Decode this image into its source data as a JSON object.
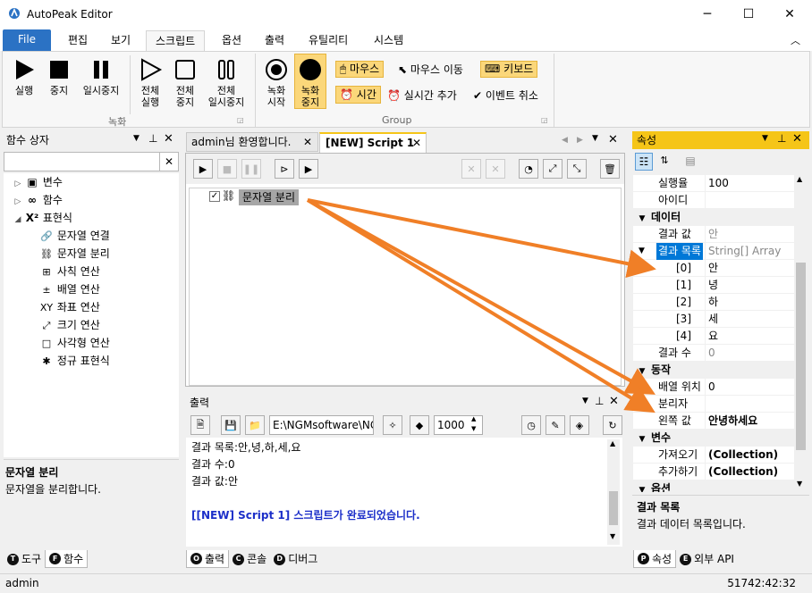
{
  "window": {
    "title": "AutoPeak Editor",
    "minimize": "─",
    "maximize": "☐",
    "close": "✕"
  },
  "ribbon_tabs": [
    "File",
    "편집",
    "보기",
    "스크립트",
    "옵션",
    "출력",
    "유틸리티",
    "시스템"
  ],
  "ribbon": {
    "record_group_label": "녹화",
    "group_label": "Group",
    "run": "실행",
    "stop": "중지",
    "pause": "일시중지",
    "run_all_1": "전체",
    "run_all_2": "실행",
    "stop_all_1": "전체",
    "stop_all_2": "중지",
    "pause_all_1": "전체",
    "pause_all_2": "일시중지",
    "rec_start_1": "녹화",
    "rec_start_2": "시작",
    "rec_stop_1": "녹화",
    "rec_stop_2": "중지",
    "mouse": "마우스",
    "mouse_move": "마우스 이동",
    "keyboard": "키보드",
    "time": "시간",
    "realtime_add": "실시간 추가",
    "event_cancel": "이벤트 취소"
  },
  "func_panel": {
    "title": "함수 상자",
    "tree": [
      {
        "label": "변수",
        "icon": "variables-icon",
        "glyph": "▣",
        "expander": "▷"
      },
      {
        "label": "함수",
        "icon": "function-icon",
        "glyph": "∞",
        "expander": "▷"
      },
      {
        "label": "표현식",
        "icon": "expression-icon",
        "glyph": "X²",
        "expander": "◢"
      }
    ],
    "children": [
      {
        "label": "문자열 연결",
        "icon": "link-icon",
        "glyph": "🔗"
      },
      {
        "label": "문자열 분리",
        "icon": "unlink-icon",
        "glyph": "⛓"
      },
      {
        "label": "사칙 연산",
        "icon": "arithmetic-icon",
        "glyph": "⊞"
      },
      {
        "label": "배열 연산",
        "icon": "plus-minus-icon",
        "glyph": "±"
      },
      {
        "label": "좌표 연산",
        "icon": "xy-icon",
        "glyph": "XY"
      },
      {
        "label": "크기 연산",
        "icon": "resize-icon",
        "glyph": "⤢"
      },
      {
        "label": "사각형 연산",
        "icon": "rectangle-icon",
        "glyph": "□"
      },
      {
        "label": "정규 표현식",
        "icon": "asterisk-icon",
        "glyph": "✱"
      }
    ],
    "desc_title": "문자열 분리",
    "desc_text": "문자열을 분리합니다.",
    "tabs": [
      {
        "label": "도구",
        "letter": "T"
      },
      {
        "label": "함수",
        "letter": "F"
      }
    ]
  },
  "editor": {
    "tabs": [
      "admin님 환영합니다.",
      "[NEW] Script 1"
    ],
    "node_label": "문자열 분리"
  },
  "output": {
    "title": "출력",
    "path": "E:\\NGMsoftware\\NG",
    "size": "1000",
    "lines": [
      "결과 목록:안,녕,하,세,요",
      "결과 수:0",
      "결과 값:안"
    ],
    "done_line": "[[NEW] Script 1] 스크립트가 완료되었습니다.",
    "tabs": [
      {
        "label": "출력",
        "letter": "O"
      },
      {
        "label": "콘솔",
        "letter": "C"
      },
      {
        "label": "디버그",
        "letter": "D"
      }
    ]
  },
  "props": {
    "title": "속성",
    "rows": [
      {
        "kind": "row",
        "name": "실행율",
        "value": "100"
      },
      {
        "kind": "row",
        "name": "아이디",
        "value": ""
      },
      {
        "kind": "cat",
        "name": "데이터"
      },
      {
        "kind": "row",
        "name": "결과 값",
        "value": "안",
        "gray": true
      },
      {
        "kind": "row",
        "name": "결과 목록",
        "value": "String[] Array",
        "sel": true,
        "gray": true
      },
      {
        "kind": "sub",
        "name": "[0]",
        "value": "안"
      },
      {
        "kind": "sub",
        "name": "[1]",
        "value": "녕"
      },
      {
        "kind": "sub",
        "name": "[2]",
        "value": "하"
      },
      {
        "kind": "sub",
        "name": "[3]",
        "value": "세"
      },
      {
        "kind": "sub",
        "name": "[4]",
        "value": "요"
      },
      {
        "kind": "row",
        "name": "결과 수",
        "value": "0",
        "gray": true
      },
      {
        "kind": "cat",
        "name": "동작"
      },
      {
        "kind": "row",
        "name": "배열 위치",
        "value": "0"
      },
      {
        "kind": "row",
        "name": "분리자",
        "value": ""
      },
      {
        "kind": "row",
        "name": "왼쪽 값",
        "value": "안녕하세요",
        "bold": true
      },
      {
        "kind": "cat",
        "name": "변수"
      },
      {
        "kind": "row",
        "name": "가져오기",
        "value": "(Collection)",
        "bold": true
      },
      {
        "kind": "row",
        "name": "추가하기",
        "value": "(Collection)",
        "bold": true
      },
      {
        "kind": "cat",
        "name": "옵션"
      }
    ],
    "desc_title": "결과 목록",
    "desc_text": "결과 데이터 목록입니다.",
    "tabs": [
      {
        "label": "속성",
        "letter": "P"
      },
      {
        "label": "외부 API",
        "letter": "E"
      }
    ]
  },
  "status": {
    "user": "admin",
    "time": "51742:42:32"
  },
  "colors": {
    "accent": "#2b72c4",
    "arrow": "#f07f27",
    "panel_header": "#f5c518",
    "selection": "#0078d7"
  }
}
